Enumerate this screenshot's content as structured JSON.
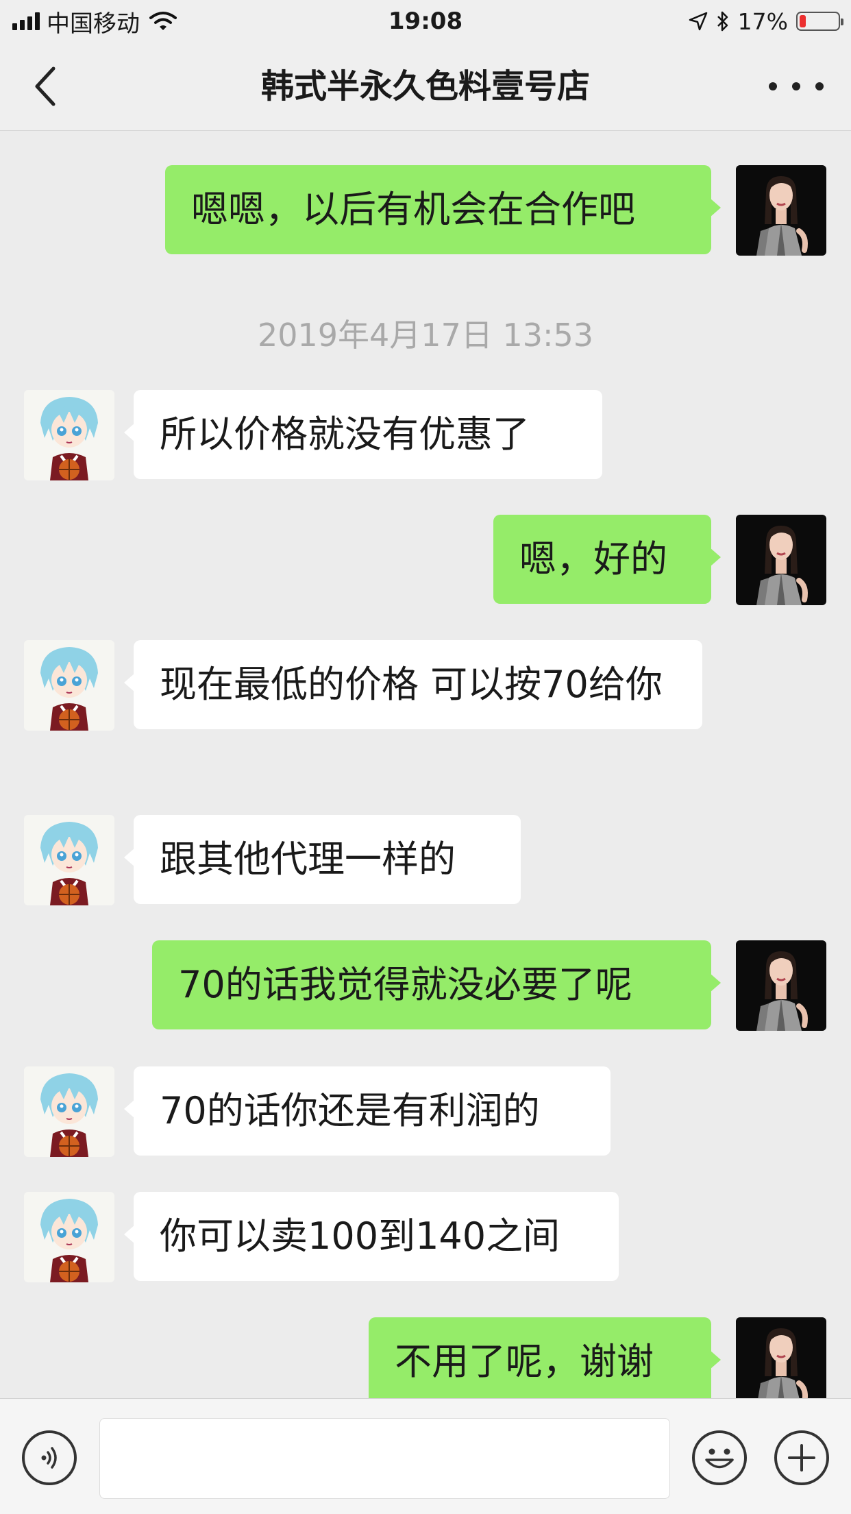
{
  "status_bar": {
    "carrier": "中国移动",
    "time": "19:08",
    "battery_percent": "17%",
    "battery_level": 0.17,
    "icons": [
      "signal-icon",
      "wifi-icon",
      "location-arrow-icon",
      "bluetooth-icon",
      "battery-icon"
    ]
  },
  "nav": {
    "title": "韩式半永久色料壹号店",
    "back_icon": "chevron-left-icon",
    "more_icon": "more-dots-icon"
  },
  "messages": [
    {
      "from": "self",
      "text": "嗯嗯，以后有机会在合作吧"
    },
    {
      "type": "timestamp",
      "text": "2019年4月17日 13:53"
    },
    {
      "from": "other",
      "text": "所以价格就没有优惠了"
    },
    {
      "from": "self",
      "text": "嗯，好的"
    },
    {
      "from": "other",
      "text": "现在最低的价格 可以按70给你"
    },
    {
      "from": "other",
      "text": "跟其他代理一样的"
    },
    {
      "from": "self",
      "text": "70的话我觉得就没必要了呢"
    },
    {
      "from": "other",
      "text": "70的话你还是有利润的"
    },
    {
      "from": "other",
      "text": "你可以卖100到140之间"
    },
    {
      "from": "self",
      "text": "不用了呢，谢谢"
    }
  ],
  "input_bar": {
    "voice_icon": "voice-icon",
    "emoji_icon": "emoji-icon",
    "plus_icon": "plus-icon",
    "message_text": ""
  },
  "colors": {
    "self_bubble": "#95ec69",
    "other_bubble": "#ffffff",
    "background": "#ececec",
    "battery_low": "#ec2f2f"
  }
}
